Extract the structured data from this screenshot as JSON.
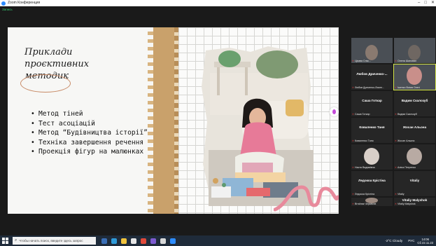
{
  "window": {
    "title": "Zoom Конференция"
  },
  "meeting": {
    "security_label": "Запись"
  },
  "slide": {
    "heading_lines": [
      "Приклади",
      "проєктивних",
      "методик"
    ],
    "bullets": [
      "Метод тіней",
      "Тест асоціацій",
      "Метод “Будівництва історії”",
      "Техніка завершення речення",
      "Проекція фігур на малюнках"
    ]
  },
  "participants": [
    {
      "name": "",
      "caption": "Цікава Сніж...",
      "video": true
    },
    {
      "name": "",
      "caption": "Олена Шаповал",
      "video": true
    },
    {
      "name": "Любов Дриченко-...",
      "caption": "Любов Дриченко-Лисен...",
      "video": false
    },
    {
      "name": "",
      "caption": "Ішенко Всіма Олегі",
      "video": true,
      "active": true
    },
    {
      "name": "Саша Готкар",
      "caption": "Саша Готкар",
      "video": false
    },
    {
      "name": "Вадим Скалозуб",
      "caption": "Вадим Скалозуб",
      "video": false
    },
    {
      "name": "Коваленко Таня",
      "caption": "Коваленко Таня",
      "video": false
    },
    {
      "name": "Жосан Альона",
      "caption": "Жосан Альона",
      "video": false
    },
    {
      "name": "",
      "caption": "Настя Вадимівна",
      "video": true
    },
    {
      "name": "",
      "caption": "Аліна Петренко",
      "video": true
    },
    {
      "name": "Ледокоа Крістіна",
      "caption": "Ледокоа Крістіна",
      "video": false
    },
    {
      "name": "Vitaliy",
      "caption": "Vitaliy",
      "video": false
    },
    {
      "name": "",
      "caption": "Вітаїлик Черкасов",
      "video": true
    },
    {
      "name": "Vitaliy Malyshok",
      "caption": "Vitaliy Malyshok",
      "video": false
    }
  ],
  "taskbar": {
    "search_placeholder": "Чтобы начать поиск, введите здесь запрос",
    "weather": "-2°C Cloudy",
    "language": "РУС",
    "time": "14:06",
    "date": "Сб 22.11.23"
  },
  "colors": {
    "accent_green": "#37c871",
    "active_speaker": "#d8e84a",
    "kraft_paper": "#c9a16b",
    "oval": "#c88a66"
  }
}
